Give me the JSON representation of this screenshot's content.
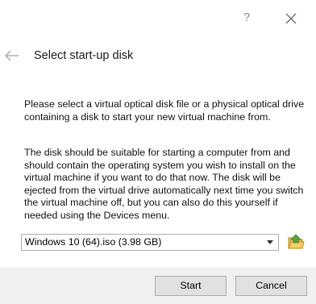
{
  "titlebar": {
    "help_label": "?",
    "close_icon": "close-icon"
  },
  "header": {
    "back_icon": "arrow-left-icon",
    "title": "Select start-up disk"
  },
  "content": {
    "paragraph1": "Please select a virtual optical disk file or a physical optical drive containing a disk to start your new virtual machine from.",
    "paragraph2": "The disk should be suitable for starting a computer from and should contain the operating system you wish to install on the virtual machine if you want to do that now. The disk will be ejected from the virtual drive automatically next time you switch the virtual machine off, but you can also do this yourself if needed using the Devices menu."
  },
  "disk_selector": {
    "selected": "Windows 10 (64).iso (3.98 GB)",
    "folder_icon": "folder-open-icon"
  },
  "footer": {
    "start_label": "Start",
    "cancel_label": "Cancel"
  },
  "colors": {
    "footer_bg": "#f0f0f0",
    "button_bg": "#e1e1e1",
    "button_border": "#adadad",
    "folder_green": "#6aa64a",
    "folder_yellow": "#f2c14e"
  }
}
